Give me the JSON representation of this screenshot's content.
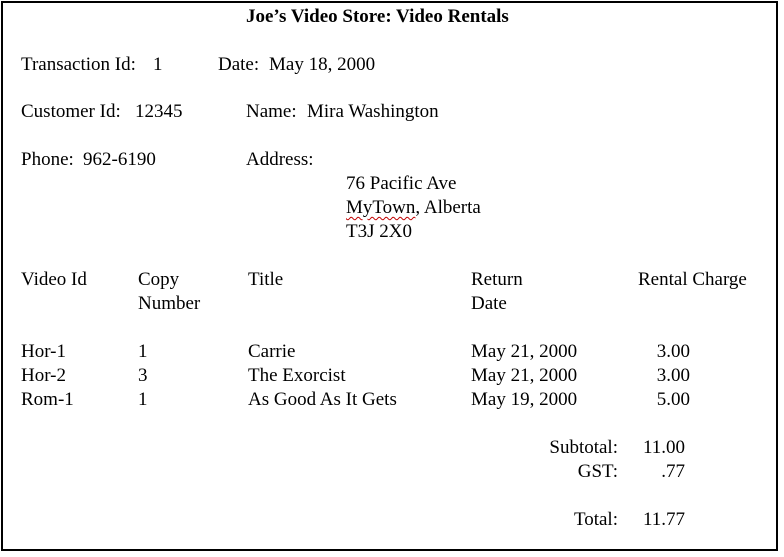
{
  "document": {
    "title": "Joe’s Video Store: Video Rentals",
    "transaction": {
      "label": "Transaction Id:",
      "value": "1"
    },
    "date": {
      "label": "Date:",
      "value": "May 18, 2000"
    },
    "customer_id": {
      "label": "Customer Id:",
      "value": "12345"
    },
    "name": {
      "label": "Name:",
      "value": "Mira Washington"
    },
    "phone": {
      "label": "Phone:",
      "value": "962-6190"
    },
    "address": {
      "label": "Address:",
      "street": "76 Pacific Ave",
      "city": "MyTown",
      "province": ", Alberta",
      "postal": "T3J 2X0"
    },
    "columns": {
      "video_id": "Video Id",
      "copy_1": "Copy",
      "copy_2": "Number",
      "title": "Title",
      "return_1": "Return",
      "return_2": "Date",
      "charge": "Rental Charge"
    },
    "rows": [
      {
        "video_id": "Hor-1",
        "copy": "1",
        "title": "Carrie",
        "return_date": "May 21, 2000",
        "charge": "3.00"
      },
      {
        "video_id": "Hor-2",
        "copy": "3",
        "title": "The Exorcist",
        "return_date": "May 21, 2000",
        "charge": "3.00"
      },
      {
        "video_id": "Rom-1",
        "copy": "1",
        "title": "As Good As It Gets",
        "return_date": "May 19, 2000",
        "charge": "5.00"
      }
    ],
    "totals": {
      "subtotal_label": "Subtotal:",
      "subtotal_value": "11.00",
      "gst_label": "GST:",
      "gst_value": ".77",
      "total_label": "Total:",
      "total_value": "11.77"
    }
  }
}
